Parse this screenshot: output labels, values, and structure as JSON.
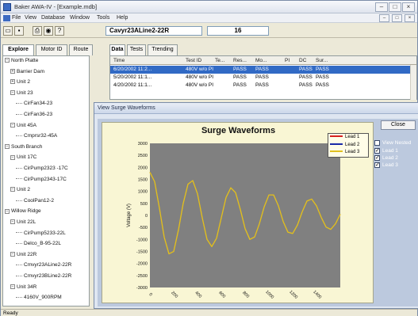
{
  "window": {
    "title": "Baker AWA-IV - [Example.mdb]"
  },
  "menu": {
    "items": [
      "File",
      "View",
      "Database",
      "Window",
      "Tools",
      "Help"
    ]
  },
  "toolbar": {
    "motor_field": "Cavyr23ALine2-22R",
    "number_field": "16"
  },
  "left_tabs": [
    "Explore",
    "Motor ID",
    "Route"
  ],
  "right_tabs": [
    "Data",
    "Tests",
    "Trending"
  ],
  "tree": [
    {
      "label": "North Platte",
      "level": 0,
      "expander": "−"
    },
    {
      "label": "Barrier Dam",
      "level": 1,
      "expander": "+"
    },
    {
      "label": "Unit 2",
      "level": 1,
      "expander": "+"
    },
    {
      "label": "Unit 23",
      "level": 1,
      "expander": "−"
    },
    {
      "label": "CirFan34-23",
      "level": 2,
      "expander": ""
    },
    {
      "label": "CirFan36-23",
      "level": 2,
      "expander": ""
    },
    {
      "label": "Unit 45A",
      "level": 1,
      "expander": "−"
    },
    {
      "label": "Cmprsr32-45A",
      "level": 2,
      "expander": ""
    },
    {
      "label": "South Branch",
      "level": 0,
      "expander": "−"
    },
    {
      "label": "Unit 17C",
      "level": 1,
      "expander": "−"
    },
    {
      "label": "CirPump2323 -17C",
      "level": 2,
      "expander": ""
    },
    {
      "label": "CirPump2343-17C",
      "level": 2,
      "expander": ""
    },
    {
      "label": "Unit 2",
      "level": 1,
      "expander": "−"
    },
    {
      "label": "CoolPan12-2",
      "level": 2,
      "expander": ""
    },
    {
      "label": "Willow Ridge",
      "level": 0,
      "expander": "−"
    },
    {
      "label": "Unit 22L",
      "level": 1,
      "expander": "−"
    },
    {
      "label": "CirPump5233-22L",
      "level": 2,
      "expander": ""
    },
    {
      "label": "Delco_B-95-22L",
      "level": 2,
      "expander": ""
    },
    {
      "label": "Unit 22R",
      "level": 1,
      "expander": "−"
    },
    {
      "label": "Cmvyr23ALine2-22R",
      "level": 2,
      "expander": ""
    },
    {
      "label": "Cmvyr23BLine2-22R",
      "level": 2,
      "expander": ""
    },
    {
      "label": "Unit 34R",
      "level": 1,
      "expander": "−"
    },
    {
      "label": "4160V_900RPM",
      "level": 2,
      "expander": ""
    }
  ],
  "grid": {
    "headers": [
      "Time",
      "Test ID",
      "Te...",
      "Res...",
      "Mo...",
      "PI",
      "DC",
      "Sur..."
    ],
    "rows": [
      [
        "6/20/2002 11:2...",
        "480V w/o PI",
        "",
        "PASS",
        "PASS",
        "",
        "PASS",
        "PASS"
      ],
      [
        "5/20/2002 11:1...",
        "480V w/o PI",
        "",
        "PASS",
        "PASS",
        "",
        "PASS",
        "PASS"
      ],
      [
        "4/20/2002 11:1...",
        "480V w/o PI",
        "",
        "PASS",
        "PASS",
        "",
        "PASS",
        "PASS"
      ]
    ]
  },
  "dialog": {
    "title": "View Surge Waveforms",
    "close_label": "Close",
    "view_nested_label": "View Nested",
    "checkboxes": [
      {
        "label": "Lead 1",
        "checked": true
      },
      {
        "label": "Lead 2",
        "checked": true
      },
      {
        "label": "Lead 3",
        "checked": true
      }
    ]
  },
  "chart_data": {
    "type": "line",
    "title": "Surge Waveforms",
    "xlabel": "µ Seconds",
    "ylabel": "Voltage (V)",
    "xlim": [
      0,
      1600
    ],
    "ylim": [
      -3000,
      3000
    ],
    "x_ticks": [
      "0",
      "200",
      "400",
      "600",
      "800",
      "1000",
      "1200",
      "1400"
    ],
    "y_ticks": [
      "3000",
      "2500",
      "2000",
      "1500",
      "1000",
      "500",
      "0",
      "-500",
      "-1000",
      "-1500",
      "-2000",
      "-2500",
      "-3000"
    ],
    "legend_position": "top-right",
    "grid": false,
    "background_color": "#808080",
    "series": [
      {
        "name": "Lead 1",
        "color": "#d62020",
        "x": [
          0,
          40,
          80,
          120,
          160,
          200,
          240,
          280,
          320,
          360,
          400,
          440,
          480,
          520,
          560,
          600,
          640,
          680,
          720,
          760,
          800,
          840,
          880,
          920,
          960,
          1000,
          1040,
          1080,
          1120,
          1160,
          1200,
          1240,
          1280,
          1320,
          1360,
          1400,
          1440,
          1480,
          1520,
          1560,
          1600
        ],
        "y": [
          1800,
          1400,
          300,
          -900,
          -1600,
          -1500,
          -600,
          500,
          1300,
          1450,
          900,
          -100,
          -1000,
          -1300,
          -950,
          -100,
          750,
          1150,
          950,
          250,
          -550,
          -1000,
          -900,
          -350,
          350,
          850,
          850,
          400,
          -250,
          -700,
          -750,
          -400,
          150,
          600,
          680,
          400,
          -80,
          -480,
          -580,
          -350,
          50
        ]
      },
      {
        "name": "Lead 2",
        "color": "#1a2aa8",
        "x": [
          0,
          40,
          80,
          120,
          160,
          200,
          240,
          280,
          320,
          360,
          400,
          440,
          480,
          520,
          560,
          600,
          640,
          680,
          720,
          760,
          800,
          840,
          880,
          920,
          960,
          1000,
          1040,
          1080,
          1120,
          1160,
          1200,
          1240,
          1280,
          1320,
          1360,
          1400,
          1440,
          1480,
          1520,
          1560,
          1600
        ],
        "y": [
          1800,
          1400,
          300,
          -900,
          -1600,
          -1500,
          -600,
          500,
          1300,
          1450,
          900,
          -100,
          -1000,
          -1300,
          -950,
          -100,
          750,
          1150,
          950,
          250,
          -550,
          -1000,
          -900,
          -350,
          350,
          850,
          850,
          400,
          -250,
          -700,
          -750,
          -400,
          150,
          600,
          680,
          400,
          -80,
          -480,
          -580,
          -350,
          50
        ]
      },
      {
        "name": "Lead 3",
        "color": "#e0c020",
        "x": [
          0,
          40,
          80,
          120,
          160,
          200,
          240,
          280,
          320,
          360,
          400,
          440,
          480,
          520,
          560,
          600,
          640,
          680,
          720,
          760,
          800,
          840,
          880,
          920,
          960,
          1000,
          1040,
          1080,
          1120,
          1160,
          1200,
          1240,
          1280,
          1320,
          1360,
          1400,
          1440,
          1480,
          1520,
          1560,
          1600
        ],
        "y": [
          1800,
          1400,
          300,
          -900,
          -1600,
          -1500,
          -600,
          500,
          1300,
          1450,
          900,
          -100,
          -1000,
          -1300,
          -950,
          -100,
          750,
          1150,
          950,
          250,
          -550,
          -1000,
          -900,
          -350,
          350,
          850,
          850,
          400,
          -250,
          -700,
          -750,
          -400,
          150,
          600,
          680,
          400,
          -80,
          -480,
          -580,
          -350,
          50
        ]
      }
    ]
  },
  "status": {
    "text": "Ready"
  }
}
